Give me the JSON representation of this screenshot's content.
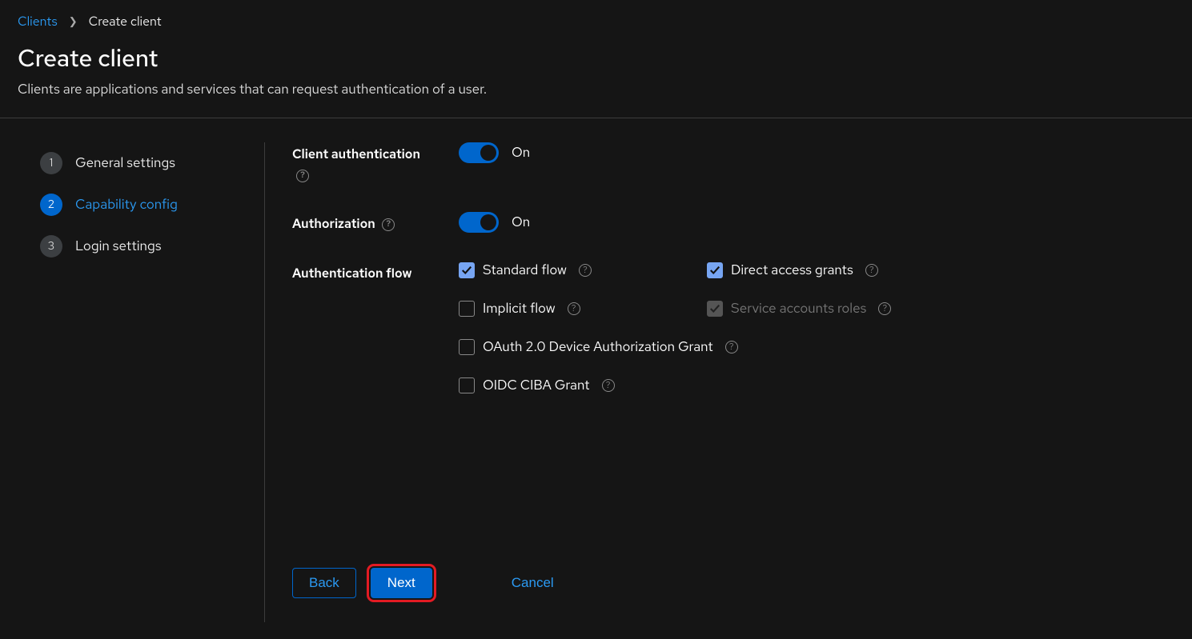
{
  "breadcrumb": {
    "link": "Clients",
    "current": "Create client"
  },
  "header": {
    "title": "Create client",
    "subtitle": "Clients are applications and services that can request authentication of a user."
  },
  "wizard": {
    "steps": [
      {
        "num": "1",
        "label": "General settings"
      },
      {
        "num": "2",
        "label": "Capability config"
      },
      {
        "num": "3",
        "label": "Login settings"
      }
    ]
  },
  "form": {
    "client_auth_label": "Client authentication",
    "client_auth_state": "On",
    "authorization_label": "Authorization",
    "authorization_state": "On",
    "auth_flow_label": "Authentication flow",
    "flows": {
      "standard": "Standard flow",
      "direct": "Direct access grants",
      "implicit": "Implicit flow",
      "service": "Service accounts roles",
      "oauth": "OAuth 2.0 Device Authorization Grant",
      "ciba": "OIDC CIBA Grant"
    }
  },
  "footer": {
    "back": "Back",
    "next": "Next",
    "cancel": "Cancel"
  }
}
